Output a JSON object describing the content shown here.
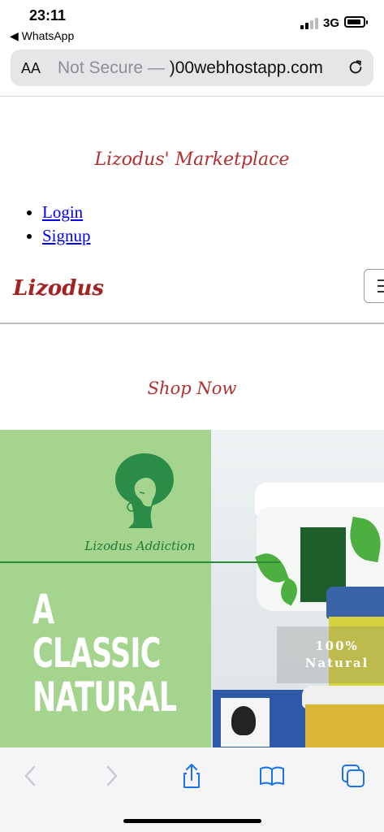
{
  "status_bar": {
    "time": "23:11",
    "back_app": "◀ WhatsApp",
    "network": "3G"
  },
  "browser": {
    "text_size_label": "AA",
    "url_prefix": "Not Secure — ",
    "url_domain": ")00webhostapp.com"
  },
  "site": {
    "title": "Lizodus' Marketplace",
    "nav": [
      {
        "label": "Login"
      },
      {
        "label": "Signup"
      }
    ],
    "brand": "Lizodus",
    "shop_heading": "Shop Now"
  },
  "banner": {
    "brand": "Lizodus Addiction",
    "tagline": [
      "A",
      "CLASSIC",
      "NATURAL"
    ],
    "overlay_line1": "100%",
    "overlay_line2": "Natural"
  },
  "colors": {
    "accent": "#b23030",
    "banner_green": "#a5d48e",
    "link": "#0000ee",
    "ios_blue": "#1a73e8"
  },
  "icons": {
    "reload": "reload-icon",
    "menu": "hamburger-icon",
    "back": "chevron-left-icon",
    "forward": "chevron-right-icon",
    "share": "share-icon",
    "bookmarks": "book-icon",
    "tabs": "tabs-icon"
  }
}
